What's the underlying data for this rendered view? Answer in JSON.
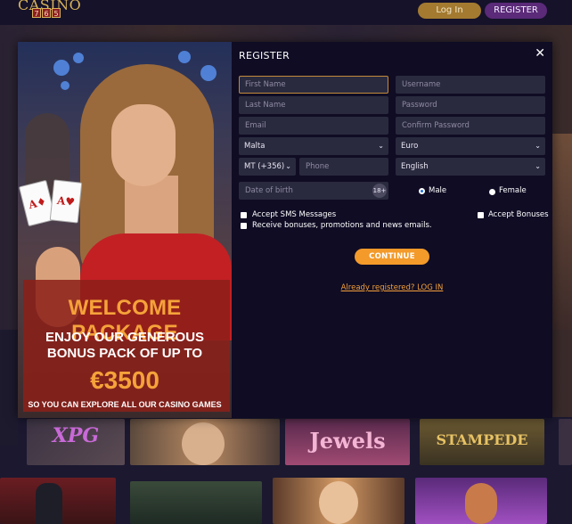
{
  "header": {
    "logo_word": "CASINO",
    "logo_digits": [
      "7",
      "6",
      "5"
    ],
    "login_label": "Log In",
    "register_label": "REGISTER"
  },
  "games": [
    {
      "label": "XPG"
    },
    {
      "label": "Jewels"
    },
    {
      "label": "STAMPEDE"
    }
  ],
  "promo": {
    "title": "WELCOME PACKAGE",
    "line1": "ENJOY OUR GENEROUS",
    "line2": "BONUS PACK OF UP TO",
    "amount": "€3500",
    "footer": "SO YOU CAN EXPLORE ALL OUR CASINO GAMES",
    "cards": [
      "A♦",
      "A♥"
    ]
  },
  "form": {
    "title": "REGISTER",
    "close_symbol": "✕",
    "first_name_placeholder": "First Name",
    "username_placeholder": "Username",
    "last_name_placeholder": "Last Name",
    "password_placeholder": "Password",
    "email_placeholder": "Email",
    "confirm_password_placeholder": "Confirm Password",
    "country_value": "Malta",
    "currency_value": "Euro",
    "phone_code_value": "MT (+356)",
    "phone_placeholder": "Phone",
    "language_value": "English",
    "dob_placeholder": "Date of birth",
    "age_badge": "18+",
    "gender_male": "Male",
    "gender_female": "Female",
    "selected_gender": "Male",
    "sms_label": "Accept SMS Messages",
    "bonuses_label": "Accept Bonuses",
    "news_label": "Receive bonuses, promotions and news emails.",
    "continue_label": "CONTINUE",
    "login_link": "Already registered? LOG IN",
    "chevron": "⌄"
  },
  "colors": {
    "modal_bg": "#0f0c24",
    "field_bg": "#2a2a3f",
    "accent_orange": "#f39a2a",
    "login_gold": "#a37a30",
    "register_purple": "#5b2a78",
    "promo_red": "#8c2018"
  }
}
